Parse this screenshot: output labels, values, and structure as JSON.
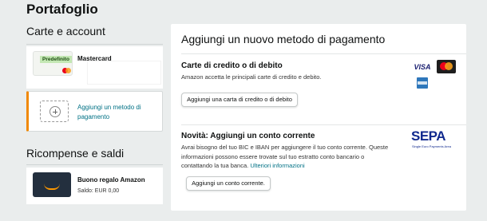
{
  "page": {
    "title": "Portafoglio"
  },
  "sidebar": {
    "cards_title": "Carte e account",
    "card": {
      "badge": "Predefinito",
      "name": "Mastercard"
    },
    "add_method_label": "Aggiungi un metodo di pagamento",
    "rewards_title": "Ricompense e saldi",
    "gift": {
      "name": "Buono regalo Amazon",
      "balance": "Saldo: EUR 0,00"
    }
  },
  "panel": {
    "title": "Aggiungi un nuovo metodo di pagamento",
    "credit": {
      "heading": "Carte di credito o di debito",
      "description": "Amazon accetta le principali carte di credito e debito.",
      "button": "Aggiungi una carta di credito o di debito",
      "logos": [
        "VISA",
        "mastercard-icon",
        "amex-icon"
      ]
    },
    "bank": {
      "heading": "Novità: Aggiungi un conto corrente",
      "description": "Avrai bisogno del tuo BIC e IBAN per aggiungere il tuo conto corrente. Queste informazioni possono essere trovate sul tuo estratto conto bancario o contattando la tua banca.",
      "link": "Ulteriori informazioni",
      "button": "Aggiungi un conto corrente.",
      "sepa_logo": "SEPA",
      "sepa_sub": "Single Euro Payments Area"
    }
  },
  "colors": {
    "accent": "#f08804",
    "link": "#007185",
    "background": "#eaeded"
  }
}
